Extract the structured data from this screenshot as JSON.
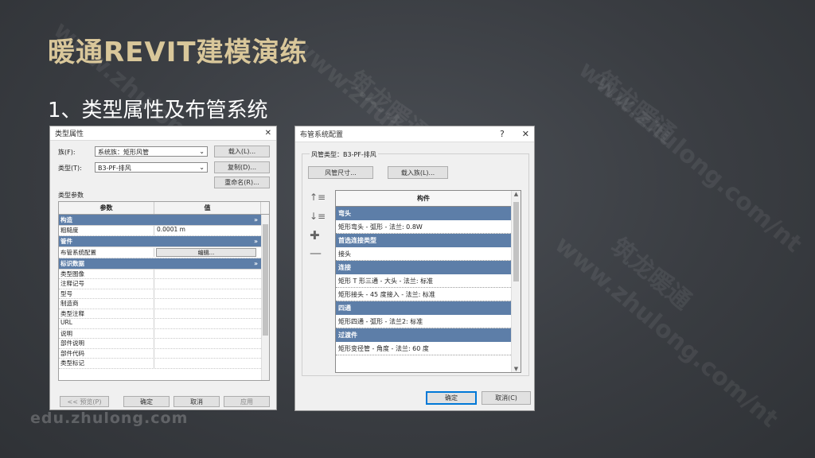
{
  "slide": {
    "title": "暖通REVIT建模演练",
    "subtitle": "1、类型属性及布管系统",
    "footer": "edu.zhulong.com"
  },
  "watermarks": [
    "www.zhulong.com/nt",
    "筑龙暖通"
  ],
  "type_properties_dialog": {
    "title": "类型属性",
    "family_label": "族(F):",
    "family_value": "系统族：矩形风管",
    "type_label": "类型(T):",
    "type_value": "B3-PF-排风",
    "load_button": "载入(L)...",
    "duplicate_button": "复制(D)...",
    "rename_button": "重命名(R)...",
    "type_params_label": "类型参数",
    "columns": [
      "参数",
      "值"
    ],
    "groups": [
      {
        "name": "构造",
        "rows": [
          {
            "k": "粗糙度",
            "v": "0.0001 m"
          }
        ]
      },
      {
        "name": "管件",
        "rows": [
          {
            "k": "布管系统配置",
            "v": "",
            "edit": "编辑..."
          }
        ]
      },
      {
        "name": "标识数据",
        "rows": [
          {
            "k": "类型图像",
            "v": ""
          },
          {
            "k": "注释记号",
            "v": ""
          },
          {
            "k": "型号",
            "v": ""
          },
          {
            "k": "制造商",
            "v": ""
          },
          {
            "k": "类型注释",
            "v": ""
          },
          {
            "k": "URL",
            "v": ""
          },
          {
            "k": "说明",
            "v": ""
          },
          {
            "k": "部件说明",
            "v": ""
          },
          {
            "k": "部件代码",
            "v": ""
          },
          {
            "k": "类型标记",
            "v": ""
          }
        ]
      }
    ],
    "preview_button": "<< 预览(P)",
    "ok_button": "确定",
    "cancel_button": "取消",
    "apply_button": "应用"
  },
  "routing_dialog": {
    "title": "布管系统配置",
    "help": "?",
    "close": "✕",
    "duct_type_label": "风管类型：",
    "duct_type_value": "B3-PF-排风",
    "duct_size_button": "风管尺寸...",
    "load_family_button": "载入族(L)...",
    "column": "构件",
    "groups": [
      {
        "name": "弯头",
        "items": [
          "矩形弯头 - 弧形 - 法兰: 0.8W"
        ]
      },
      {
        "name": "首选连接类型",
        "items": [
          "接头"
        ]
      },
      {
        "name": "连接",
        "items": [
          "矩形 T 形三通 - 大头 - 法兰: 标准",
          "矩形接头 - 45 度接入 - 法兰: 标准"
        ]
      },
      {
        "name": "四通",
        "items": [
          "矩形四通 - 弧形 - 法兰2: 标准"
        ]
      },
      {
        "name": "过渡件",
        "items": [
          "矩形变径管 - 角度 - 法兰: 60 度"
        ]
      }
    ],
    "ok_button": "确定",
    "cancel_button": "取消(C)"
  }
}
